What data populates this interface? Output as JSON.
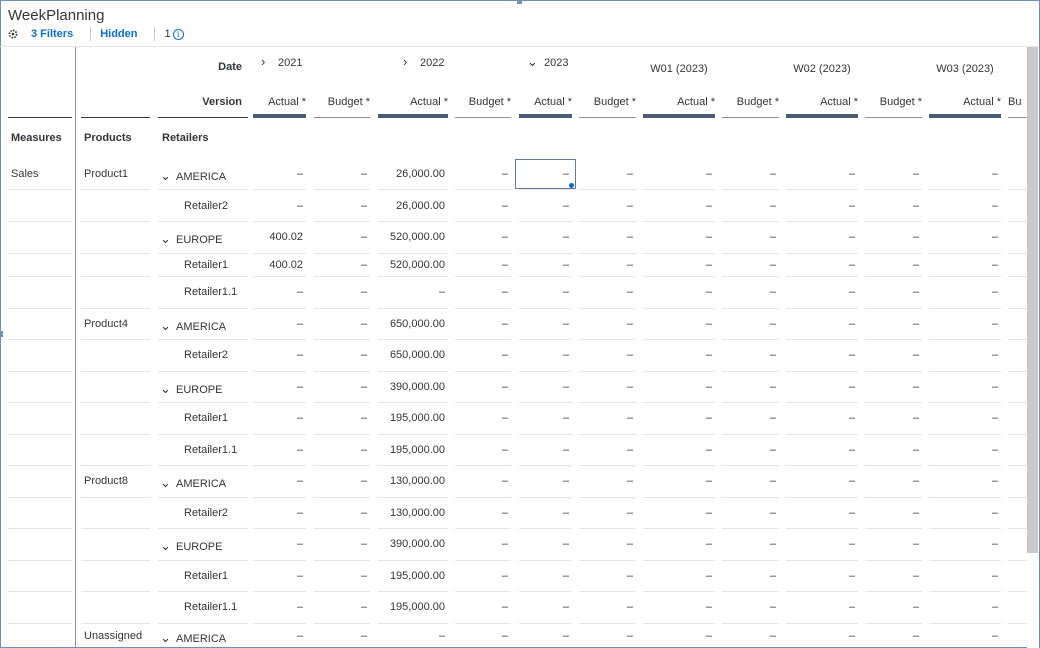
{
  "title": "WeekPlanning",
  "toolbar": {
    "filters_label": "3 Filters",
    "hidden_label": "Hidden",
    "count_label": "1",
    "info_glyph": "i"
  },
  "header": {
    "date_label": "Date",
    "version_label": "Version",
    "measures_label": "Measures",
    "products_label": "Products",
    "retailers_label": "Retailers",
    "years": [
      {
        "label": "2021",
        "chevron": "›"
      },
      {
        "label": "2022",
        "chevron": "›"
      },
      {
        "label": "2023",
        "chevron": "⌄"
      }
    ],
    "weeks": [
      "W01 (2023)",
      "W02 (2023)",
      "W03 (2023)"
    ],
    "versions": [
      "Actual *",
      "Budget *",
      "Actual *",
      "Budget *",
      "Actual *",
      "Budget *",
      "Actual *",
      "Budget *",
      "Actual *",
      "Budget *",
      "Actual *",
      "Bu"
    ]
  },
  "rows": [
    {
      "measure": "Sales",
      "product": "Product1",
      "retailer": "AMERICA",
      "expand": "⌄",
      "values": [
        "–",
        "–",
        "26,000.00",
        "–",
        "–",
        "–",
        "–",
        "–",
        "–",
        "–",
        "–"
      ]
    },
    {
      "measure": "",
      "product": "",
      "retailer": "Retailer2",
      "expand": "",
      "values": [
        "–",
        "–",
        "26,000.00",
        "–",
        "–",
        "–",
        "–",
        "–",
        "–",
        "–",
        "–"
      ]
    },
    {
      "measure": "",
      "product": "",
      "retailer": "EUROPE",
      "expand": "⌄",
      "values": [
        "400.02",
        "–",
        "520,000.00",
        "–",
        "–",
        "–",
        "–",
        "–",
        "–",
        "–",
        "–"
      ]
    },
    {
      "measure": "",
      "product": "",
      "retailer": "Retailer1",
      "expand": "",
      "values": [
        "400.02",
        "–",
        "520,000.00",
        "–",
        "–",
        "–",
        "–",
        "–",
        "–",
        "–",
        "–"
      ]
    },
    {
      "measure": "",
      "product": "",
      "retailer": "Retailer1.1",
      "expand": "",
      "values": [
        "–",
        "–",
        "–",
        "–",
        "–",
        "–",
        "–",
        "–",
        "–",
        "–",
        "–"
      ]
    },
    {
      "measure": "",
      "product": "Product4",
      "retailer": "AMERICA",
      "expand": "⌄",
      "values": [
        "–",
        "–",
        "650,000.00",
        "–",
        "–",
        "–",
        "–",
        "–",
        "–",
        "–",
        "–"
      ]
    },
    {
      "measure": "",
      "product": "",
      "retailer": "Retailer2",
      "expand": "",
      "values": [
        "–",
        "–",
        "650,000.00",
        "–",
        "–",
        "–",
        "–",
        "–",
        "–",
        "–",
        "–"
      ]
    },
    {
      "measure": "",
      "product": "",
      "retailer": "EUROPE",
      "expand": "⌄",
      "values": [
        "–",
        "–",
        "390,000.00",
        "–",
        "–",
        "–",
        "–",
        "–",
        "–",
        "–",
        "–"
      ]
    },
    {
      "measure": "",
      "product": "",
      "retailer": "Retailer1",
      "expand": "",
      "values": [
        "–",
        "–",
        "195,000.00",
        "–",
        "–",
        "–",
        "–",
        "–",
        "–",
        "–",
        "–"
      ]
    },
    {
      "measure": "",
      "product": "",
      "retailer": "Retailer1.1",
      "expand": "",
      "values": [
        "–",
        "–",
        "195,000.00",
        "–",
        "–",
        "–",
        "–",
        "–",
        "–",
        "–",
        "–"
      ]
    },
    {
      "measure": "",
      "product": "Product8",
      "retailer": "AMERICA",
      "expand": "⌄",
      "values": [
        "–",
        "–",
        "130,000.00",
        "–",
        "–",
        "–",
        "–",
        "–",
        "–",
        "–",
        "–"
      ]
    },
    {
      "measure": "",
      "product": "",
      "retailer": "Retailer2",
      "expand": "",
      "values": [
        "–",
        "–",
        "130,000.00",
        "–",
        "–",
        "–",
        "–",
        "–",
        "–",
        "–",
        "–"
      ]
    },
    {
      "measure": "",
      "product": "",
      "retailer": "EUROPE",
      "expand": "⌄",
      "values": [
        "–",
        "–",
        "390,000.00",
        "–",
        "–",
        "–",
        "–",
        "–",
        "–",
        "–",
        "–"
      ]
    },
    {
      "measure": "",
      "product": "",
      "retailer": "Retailer1",
      "expand": "",
      "values": [
        "–",
        "–",
        "195,000.00",
        "–",
        "–",
        "–",
        "–",
        "–",
        "–",
        "–",
        "–"
      ]
    },
    {
      "measure": "",
      "product": "",
      "retailer": "Retailer1.1",
      "expand": "",
      "values": [
        "–",
        "–",
        "195,000.00",
        "–",
        "–",
        "–",
        "–",
        "–",
        "–",
        "–",
        "–"
      ]
    },
    {
      "measure": "",
      "product": "Unassigned",
      "retailer": "AMERICA",
      "expand": "⌄",
      "values": [
        "–",
        "–",
        "–",
        "–",
        "–",
        "–",
        "–",
        "–",
        "–",
        "–",
        "–"
      ]
    }
  ],
  "colors": {
    "accent": "#0a6ed1",
    "header_bar": "#475e75",
    "grid_line": "#e5e5e5",
    "text": "#32363a"
  }
}
